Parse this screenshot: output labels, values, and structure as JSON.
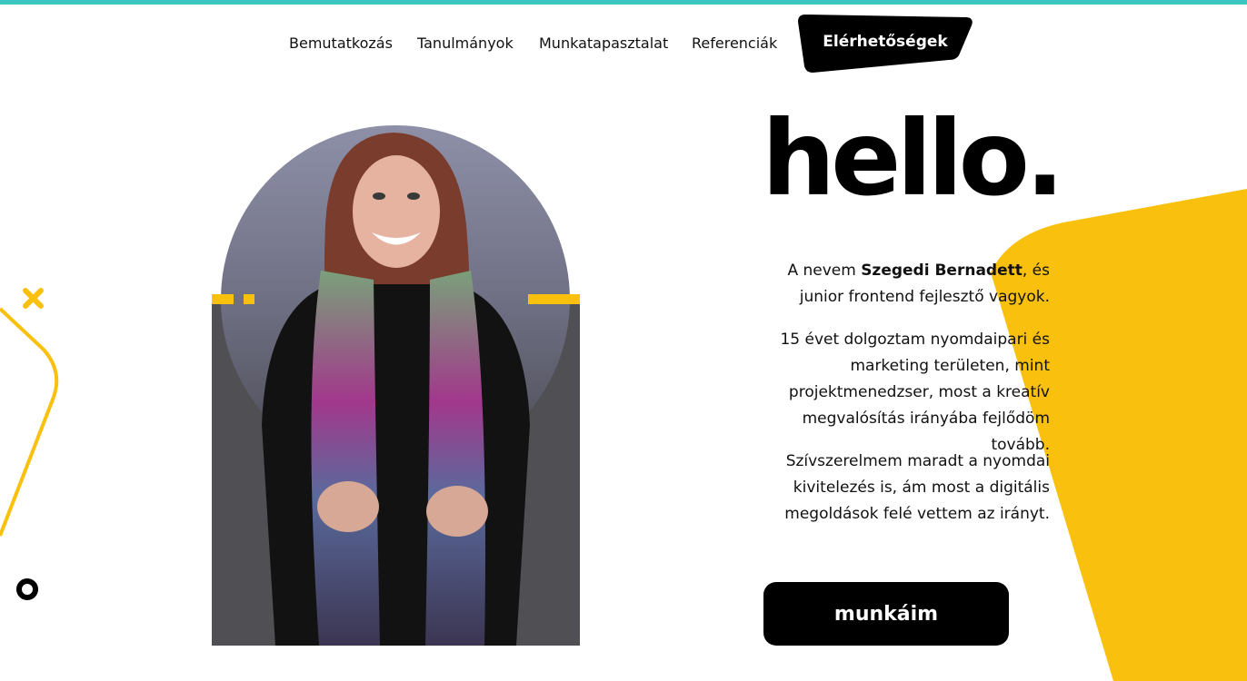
{
  "nav": {
    "items": [
      {
        "label": "Bemutatkozás"
      },
      {
        "label": "Tanulmányok"
      },
      {
        "label": "Munkatapasztalat"
      },
      {
        "label": "Referenciák"
      }
    ],
    "cta_label": "Elérhetőségek"
  },
  "hero": {
    "greeting": "hello.",
    "intro_prefix": "A nevem ",
    "name": "Szegedi Bernadett",
    "intro_suffix": ", és junior frontend fejlesztő vagyok.",
    "paragraph2": "15 évet dolgoztam nyomdaipari és marketing területen, mint projektmenedzser, most a kreatív megvalósítás irányába fejlődöm tovább.",
    "paragraph3": "Szívszerelmem maradt a nyomdai kivitelezés is, ám most a digitális megoldások felé vettem az irányt.",
    "button_label": "munkáim"
  },
  "colors": {
    "accent_yellow": "#f9c10e",
    "teal_bar": "#3cc8c2",
    "dark": "#000000"
  },
  "icons": [
    "x-mark-icon",
    "ring-icon"
  ]
}
